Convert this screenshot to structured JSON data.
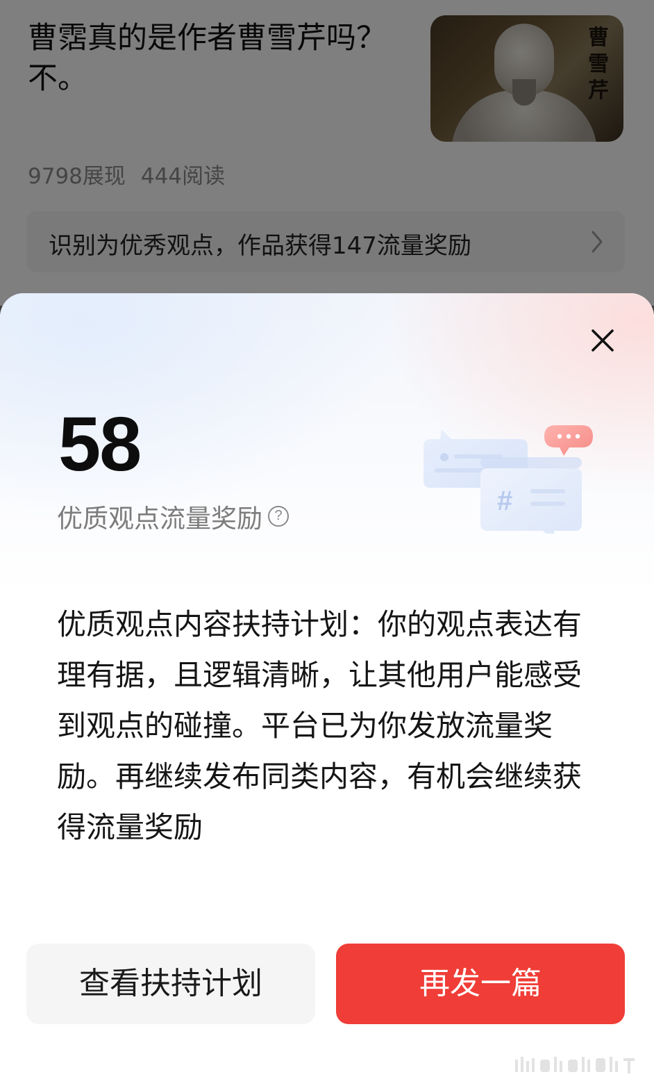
{
  "article": {
    "title": "曹霑真的是作者曹雪芹吗？不。",
    "thumbnail_caption": "曹雪芹",
    "impressions": "9798展现",
    "reads": "444阅读",
    "reward_notice": "识别为优秀观点，作品获得147流量奖励"
  },
  "sheet": {
    "reward_amount": "58",
    "reward_label": "优质观点流量奖励",
    "help_glyph": "?",
    "description": "优质观点内容扶持计划：你的观点表达有理有据，且逻辑清晰，让其他用户能感受到观点的碰撞。平台已为你发放流量奖励。再继续发布同类内容，有机会继续获得流量奖励",
    "secondary_button": "查看扶持计划",
    "primary_button": "再发一篇"
  },
  "icons": {
    "close": "close-icon",
    "chevron": "chevron-right-icon",
    "help": "help-circle-icon",
    "illustration": "chat-bubbles-illustration"
  },
  "colors": {
    "primary": "#f03d37",
    "secondary_bg": "#f5f5f5"
  }
}
